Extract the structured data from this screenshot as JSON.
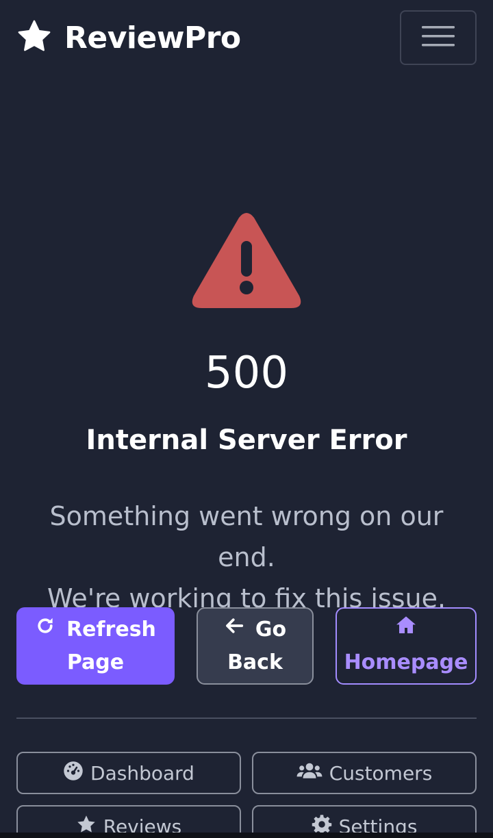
{
  "navbar": {
    "brand_name": "ReviewPro",
    "brand_icon": "star-icon",
    "menu_icon": "hamburger-menu-icon"
  },
  "error": {
    "icon": "warning-triangle-icon",
    "code": "500",
    "title": "Internal Server Error",
    "message_line1": "Something went wrong on our end.",
    "message_line2": "We're working to fix this issue."
  },
  "actions": {
    "refresh": {
      "label_line1": "Refresh",
      "label_line2": "Page",
      "icon": "refresh-icon"
    },
    "back": {
      "label_line1": "Go",
      "label_line2": "Back",
      "icon": "arrow-left-icon"
    },
    "home": {
      "label": "Homepage",
      "icon": "home-icon"
    }
  },
  "quick_links": [
    {
      "label": "Dashboard",
      "icon": "dashboard-icon"
    },
    {
      "label": "Customers",
      "icon": "users-icon"
    },
    {
      "label": "Reviews",
      "icon": "star-icon"
    },
    {
      "label": "Settings",
      "icon": "gear-icon"
    }
  ],
  "colors": {
    "background": "#1e2333",
    "accent": "#7b5cff",
    "accent_light": "#a98dff",
    "warning": "#c85555",
    "muted_text": "#b9bfcd"
  }
}
